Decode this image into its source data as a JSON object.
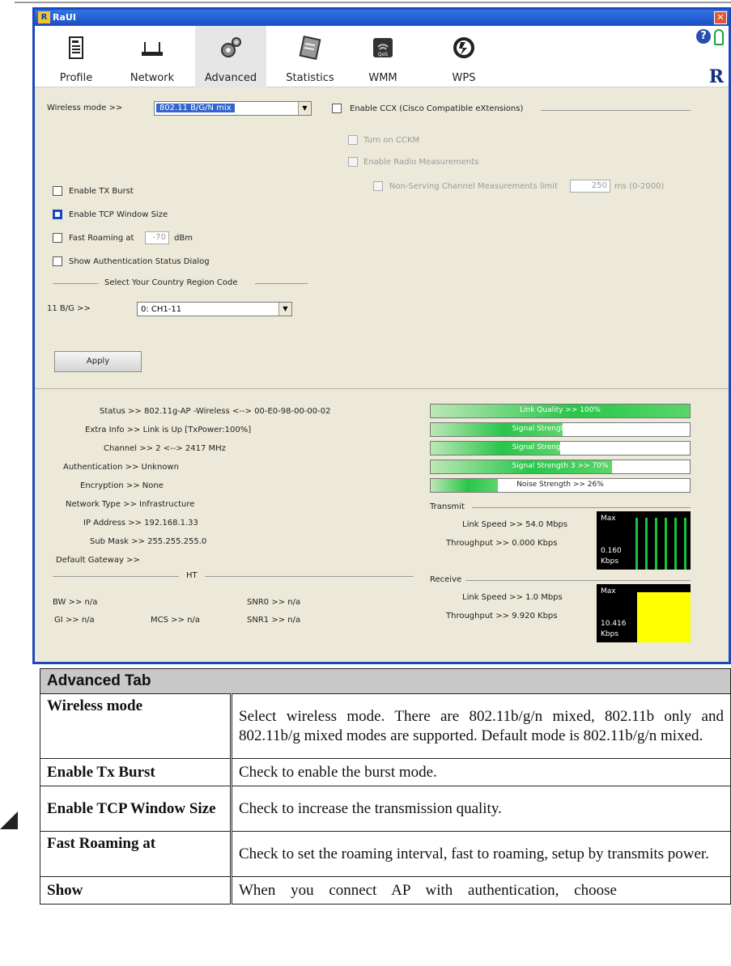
{
  "window": {
    "title": "RaUI",
    "close": "✕"
  },
  "tabs": [
    {
      "label": "Profile"
    },
    {
      "label": "Network"
    },
    {
      "label": "Advanced"
    },
    {
      "label": "Statistics"
    },
    {
      "label": "WMM"
    },
    {
      "label": "WPS"
    }
  ],
  "advanced": {
    "wireless_mode_label": "Wireless mode >>",
    "wireless_mode_value": "802.11 B/G/N mix",
    "ccx_label": "Enable CCX (Cisco Compatible eXtensions)",
    "cckm_label": "Turn on CCKM",
    "radio_measure_label": "Enable Radio Measurements",
    "nonserving_label": "Non-Serving Channel Measurements limit",
    "nonserving_value": "250",
    "nonserving_unit": "ms (0-2000)",
    "tx_burst_label": "Enable TX Burst",
    "tcp_window_label": "Enable TCP Window Size",
    "fast_roaming_label": "Fast Roaming at",
    "fast_roaming_value": "-70",
    "fast_roaming_unit": "dBm",
    "show_auth_label": "Show Authentication Status Dialog",
    "country_group_label": "Select Your Country Region Code",
    "bg_label": "11 B/G >>",
    "bg_value": "0: CH1-11",
    "apply_label": "Apply"
  },
  "status": {
    "status_line": "Status >> 802.11g-AP -Wireless <--> 00-E0-98-00-00-02",
    "extra_info": "Extra Info >> Link is Up [TxPower:100%]",
    "channel": "Channel >> 2 <--> 2417 MHz",
    "authentication": "Authentication >> Unknown",
    "encryption": "Encryption >> None",
    "network_type": "Network Type >> Infrastructure",
    "ip_address": "IP Address >> 192.168.1.33",
    "sub_mask": "Sub Mask >> 255.255.255.0",
    "default_gateway": "Default Gateway >>",
    "ht_label": "HT",
    "bw": "BW >> n/a",
    "gi": "GI >> n/a",
    "mcs": "MCS >> n/a",
    "snr0": "SNR0 >> n/a",
    "snr1": "SNR1 >> n/a"
  },
  "signal": {
    "link_quality": {
      "text": "Link Quality >> 100%",
      "level": 1.0
    },
    "signal1": {
      "text": "Signal Strength 1 >> 51%",
      "level": 0.51
    },
    "signal2": {
      "text": "Signal Strength 2 >> 50%",
      "level": 0.5
    },
    "signal3": {
      "text": "Signal Strength 3 >> 70%",
      "level": 0.7
    },
    "noise": {
      "text": "Noise Strength >> 26%",
      "level": 0.26
    }
  },
  "transmit": {
    "label": "Transmit",
    "link_speed": "Link Speed >> 54.0 Mbps",
    "throughput": "Throughput >> 0.000 Kbps",
    "max": "Max",
    "value": "0.160",
    "unit": "Kbps"
  },
  "receive": {
    "label": "Receive",
    "link_speed": "Link Speed >> 1.0 Mbps",
    "throughput": "Throughput >> 9.920 Kbps",
    "max": "Max",
    "value": "10.416",
    "unit": "Kbps"
  },
  "doc": {
    "header": "Advanced Tab",
    "rows": [
      {
        "name": "Wireless mode",
        "desc": "Select wireless mode. There are 802.11b/g/n mixed, 802.11b only and 802.11b/g mixed modes are supported. Default mode is 802.11b/g/n mixed."
      },
      {
        "name": "Enable Tx Burst",
        "desc": "Check to enable the burst mode."
      },
      {
        "name": "Enable TCP Window Size",
        "desc": "Check to increase the transmission quality."
      },
      {
        "name": "Fast Roaming at",
        "desc": "Check to set the roaming interval, fast to roaming, setup by transmits power."
      },
      {
        "name": "Show",
        "desc": "When you connect AP with authentication, choose"
      }
    ]
  },
  "colors": {
    "titlebar": "#1c4ec5",
    "signal": "#28c64a",
    "rx_graph": "#ffff00",
    "tx_graph": "#19c23a"
  }
}
